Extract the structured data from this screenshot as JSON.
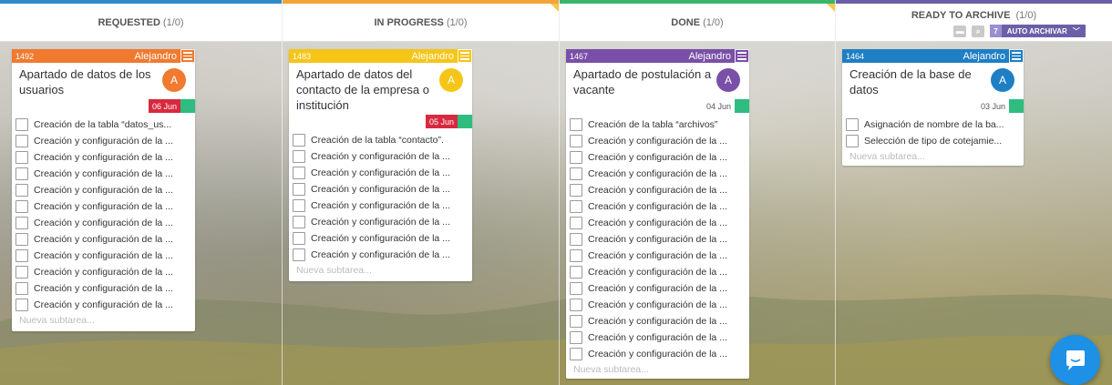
{
  "columns": [
    {
      "title": "REQUESTED",
      "count": "(1/0)",
      "accent": "#2f8bc9",
      "card": {
        "id": "1492",
        "owner": "Alejandro",
        "bar_color": "#f07a2f",
        "title": "Apartado de datos de los usuarios",
        "avatar_letter": "A",
        "avatar_color": "#f07a2f",
        "date": "06 Jun",
        "date_bg": "#d8293f",
        "date_color": "#ffffff",
        "subtasks": [
          "Creación de la tabla “datos_us...",
          "Creación y configuración de la ...",
          "Creación y configuración de la ...",
          "Creación y configuración de la ...",
          "Creación y configuración de la ...",
          "Creación y configuración de la ...",
          "Creación y configuración de la ...",
          "Creación y configuración de la ...",
          "Creación y configuración de la ...",
          "Creación y configuración de la ...",
          "Creación y configuración de la ...",
          "Creación y configuración de la ..."
        ],
        "new_subtask_placeholder": "Nueva subtarea..."
      }
    },
    {
      "title": "IN PROGRESS",
      "count": "(1/0)",
      "accent": "#f2a33a",
      "card": {
        "id": "1483",
        "owner": "Alejandro",
        "bar_color": "#f5c518",
        "title": "Apartado de datos del contacto de la empresa o institución",
        "avatar_letter": "A",
        "avatar_color": "#f5c518",
        "date": "05 Jun",
        "date_bg": "#d8293f",
        "date_color": "#ffffff",
        "subtasks": [
          "Creación de la tabla “contacto”.",
          "Creación y configuración de la ...",
          "Creación y configuración de la ...",
          "Creación y configuración de la ...",
          "Creación y configuración de la ...",
          "Creación y configuración de la ...",
          "Creación y configuración de la ...",
          "Creación y configuración de la ..."
        ],
        "new_subtask_placeholder": "Nueva subtarea..."
      }
    },
    {
      "title": "DONE",
      "count": "(1/0)",
      "accent": "#3bb56c",
      "card": {
        "id": "1467",
        "owner": "Alejandro",
        "bar_color": "#7a4fa8",
        "title": "Apartado de postulación a vacante",
        "avatar_letter": "A",
        "avatar_color": "#7a4fa8",
        "date": "04 Jun",
        "date_bg": "#ffffff",
        "date_color": "#555555",
        "subtasks": [
          "Creación de la tabla “archivos”",
          "Creación y configuración de la ...",
          "Creación y configuración de la ...",
          "Creación y configuración de la ...",
          "Creación y configuración de la ...",
          "Creación y configuración de la ...",
          "Creación y configuración de la ...",
          "Creación y configuración de la ...",
          "Creación y configuración de la ...",
          "Creación y configuración de la ...",
          "Creación y configuración de la ...",
          "Creación y configuración de la ...",
          "Creación y configuración de la ...",
          "Creación y configuración de la ...",
          "Creación y configuración de la ..."
        ],
        "new_subtask_placeholder": "Nueva subtarea..."
      }
    },
    {
      "title": "READY TO ARCHIVE",
      "count": "(1/0)",
      "accent": "#6b5fa8",
      "card": {
        "id": "1464",
        "owner": "Alejandro",
        "bar_color": "#1f7fc4",
        "title": "Creación de la base de datos",
        "avatar_letter": "A",
        "avatar_color": "#1f7fc4",
        "date": "03 Jun",
        "date_bg": "#ffffff",
        "date_color": "#555555",
        "subtasks": [
          "Asignación de nombre de la ba...",
          "Selección de tipo de cotejamie..."
        ],
        "new_subtask_placeholder": "Nueva subtarea..."
      }
    }
  ],
  "archive_tools": {
    "icons": [
      "archive-box-icon",
      "search-icon"
    ],
    "auto_count": "7",
    "auto_label": "AUTO ARCHIVAR",
    "auto_color": "#6b5fa8"
  },
  "chat": {
    "icon": "chat-bubble-icon",
    "color": "#1e90e6"
  },
  "colors": {
    "corner_marker": "#f2c94c",
    "date_done": "#2ebd7f"
  }
}
